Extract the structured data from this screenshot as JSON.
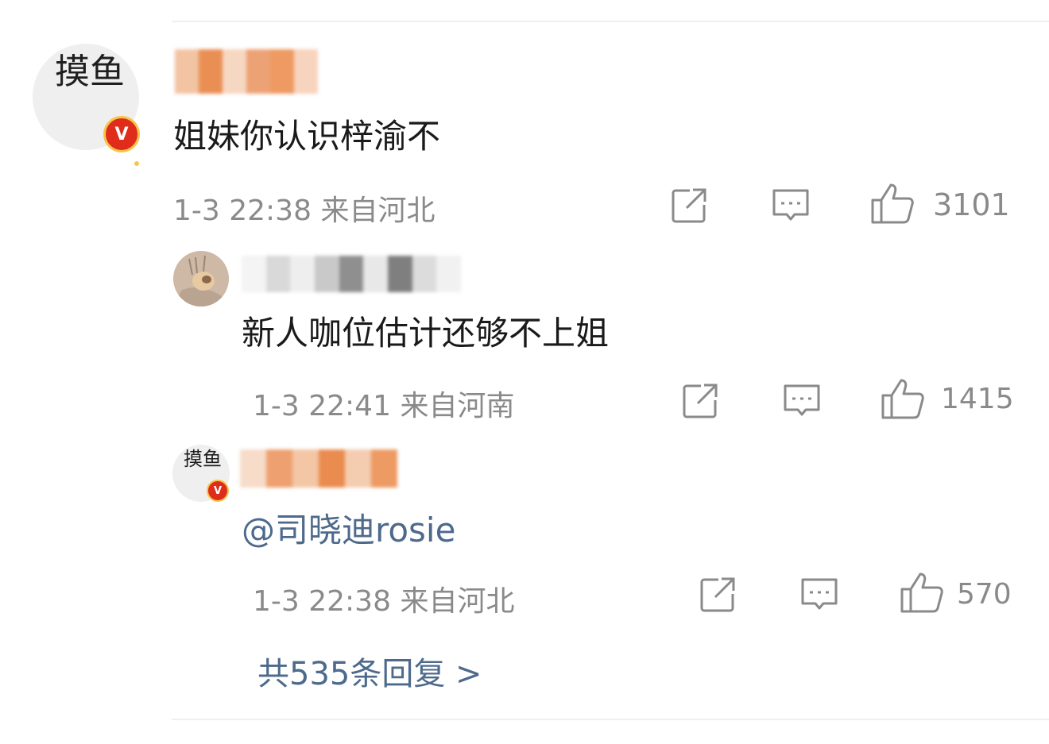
{
  "comment": {
    "avatar_text": "摸鱼",
    "badge": "V",
    "text": "姐妹你认识梓渝不",
    "time": "1-3 22:38",
    "location": "来自河北",
    "likes": "3101"
  },
  "replies": [
    {
      "text": "新人咖位估计还够不上姐",
      "time": "1-3 22:41",
      "location": "来自河南",
      "likes": "1415"
    },
    {
      "avatar_text": "摸鱼",
      "badge": "V",
      "mention": "@司晓迪rosie",
      "time": "1-3 22:38",
      "location": "来自河北",
      "likes": "570"
    }
  ],
  "more_replies_label": "共535条回复 >",
  "colors": {
    "link": "#4d6a8c",
    "meta": "#8a8a8a",
    "badge": "#e02c1a"
  }
}
